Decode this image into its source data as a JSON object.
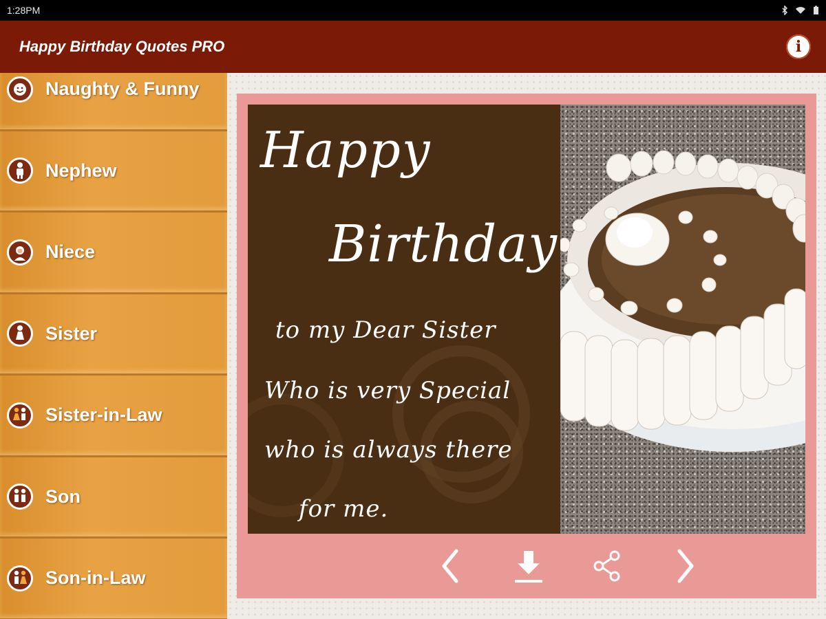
{
  "status_bar": {
    "time": "1:28PM"
  },
  "app_bar": {
    "title": "Happy Birthday Quotes PRO"
  },
  "sidebar": {
    "items": [
      {
        "label": "Naughty & Funny",
        "icon": "face-icon"
      },
      {
        "label": "Nephew",
        "icon": "boy-icon"
      },
      {
        "label": "Niece",
        "icon": "girl-icon"
      },
      {
        "label": "Sister",
        "icon": "woman-icon"
      },
      {
        "label": "Sister-in-Law",
        "icon": "couple-icon"
      },
      {
        "label": "Son",
        "icon": "son-icon"
      },
      {
        "label": "Son-in-Law",
        "icon": "couple-icon"
      }
    ]
  },
  "card": {
    "line1": "Happy",
    "line2": "Birthday",
    "line3": "to my Dear  Sister",
    "line4": "Who is very Special",
    "line5": "who is always there",
    "line6": "for me."
  },
  "controls": [
    "previous",
    "download",
    "share",
    "next"
  ]
}
